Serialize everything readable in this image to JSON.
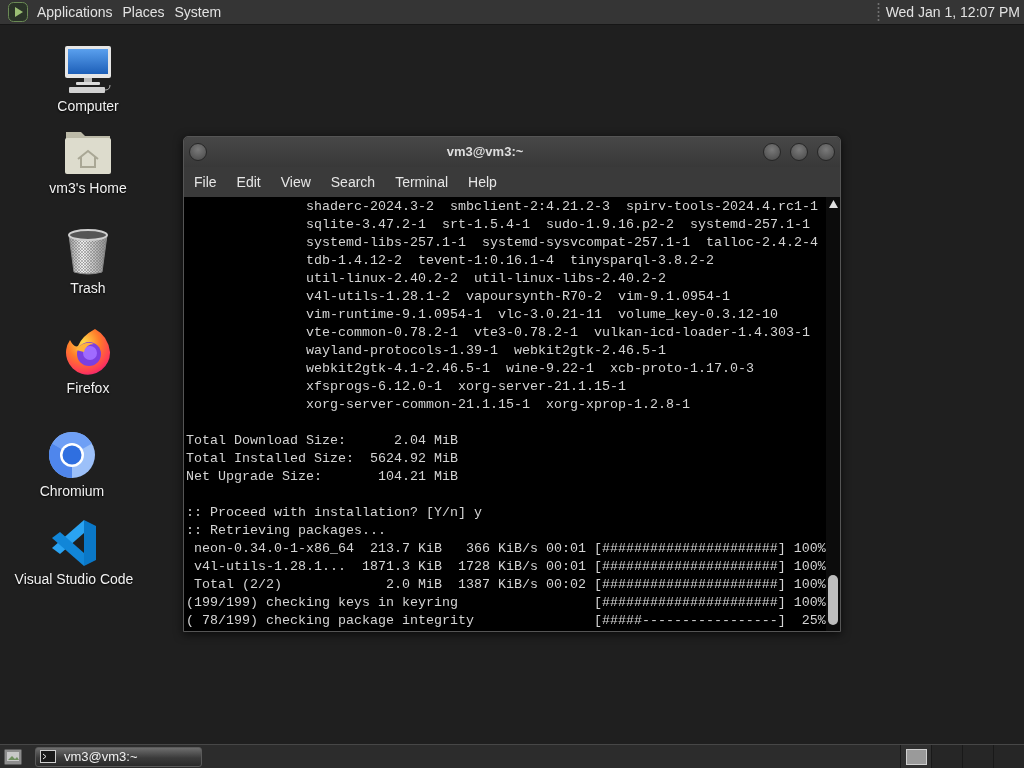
{
  "top_panel": {
    "menus": [
      "Applications",
      "Places",
      "System"
    ],
    "clock": "Wed Jan 1, 12:07 PM"
  },
  "desktop_icons": [
    {
      "kind": "computer",
      "label": "Computer"
    },
    {
      "kind": "home",
      "label": "vm3's Home"
    },
    {
      "kind": "trash",
      "label": "Trash"
    },
    {
      "kind": "firefox",
      "label": "Firefox"
    },
    {
      "kind": "chromium",
      "label": "Chromium"
    },
    {
      "kind": "vscode",
      "label": "Visual Studio Code"
    }
  ],
  "terminal_window": {
    "title": "vm3@vm3:~",
    "menus": [
      "File",
      "Edit",
      "View",
      "Search",
      "Terminal",
      "Help"
    ],
    "blocks": [
      {
        "kind": "packages",
        "lines": [
          "shaderc-2024.3-2  smbclient-2:4.21.2-3  spirv-tools-2024.4.rc1-1",
          "sqlite-3.47.2-1  srt-1.5.4-1  sudo-1.9.16.p2-2  systemd-257.1-1",
          "systemd-libs-257.1-1  systemd-sysvcompat-257.1-1  talloc-2.4.2-4",
          "tdb-1.4.12-2  tevent-1:0.16.1-4  tinysparql-3.8.2-2",
          "util-linux-2.40.2-2  util-linux-libs-2.40.2-2",
          "v4l-utils-1.28.1-2  vapoursynth-R70-2  vim-9.1.0954-1",
          "vim-runtime-9.1.0954-1  vlc-3.0.21-11  volume_key-0.3.12-10",
          "vte-common-0.78.2-1  vte3-0.78.2-1  vulkan-icd-loader-1.4.303-1",
          "wayland-protocols-1.39-1  webkit2gtk-2.46.5-1",
          "webkit2gtk-4.1-2.46.5-1  wine-9.22-1  xcb-proto-1.17.0-3",
          "xfsprogs-6.12.0-1  xorg-server-21.1.15-1",
          "xorg-server-common-21.1.15-1  xorg-xprop-1.2.8-1"
        ]
      },
      {
        "kind": "output",
        "lines": [
          "Total Download Size:      2.04 MiB",
          "Total Installed Size:  5624.92 MiB",
          "Net Upgrade Size:       104.21 MiB"
        ]
      },
      {
        "kind": "output",
        "lines": [
          ":: Proceed with installation? [Y/n] y",
          ":: Retrieving packages...",
          " neon-0.34.0-1-x86_64  213.7 KiB   366 KiB/s 00:01 [######################] 100%",
          " v4l-utils-1.28.1...  1871.3 KiB  1728 KiB/s 00:01 [######################] 100%",
          " Total (2/2)             2.0 MiB  1387 KiB/s 00:02 [######################] 100%",
          "(199/199) checking keys in keyring                 [######################] 100%",
          "( 78/199) checking package integrity               [#####-----------------]  25%"
        ]
      }
    ]
  },
  "taskbar": {
    "tasks": [
      {
        "label": "vm3@vm3:~"
      }
    ]
  }
}
